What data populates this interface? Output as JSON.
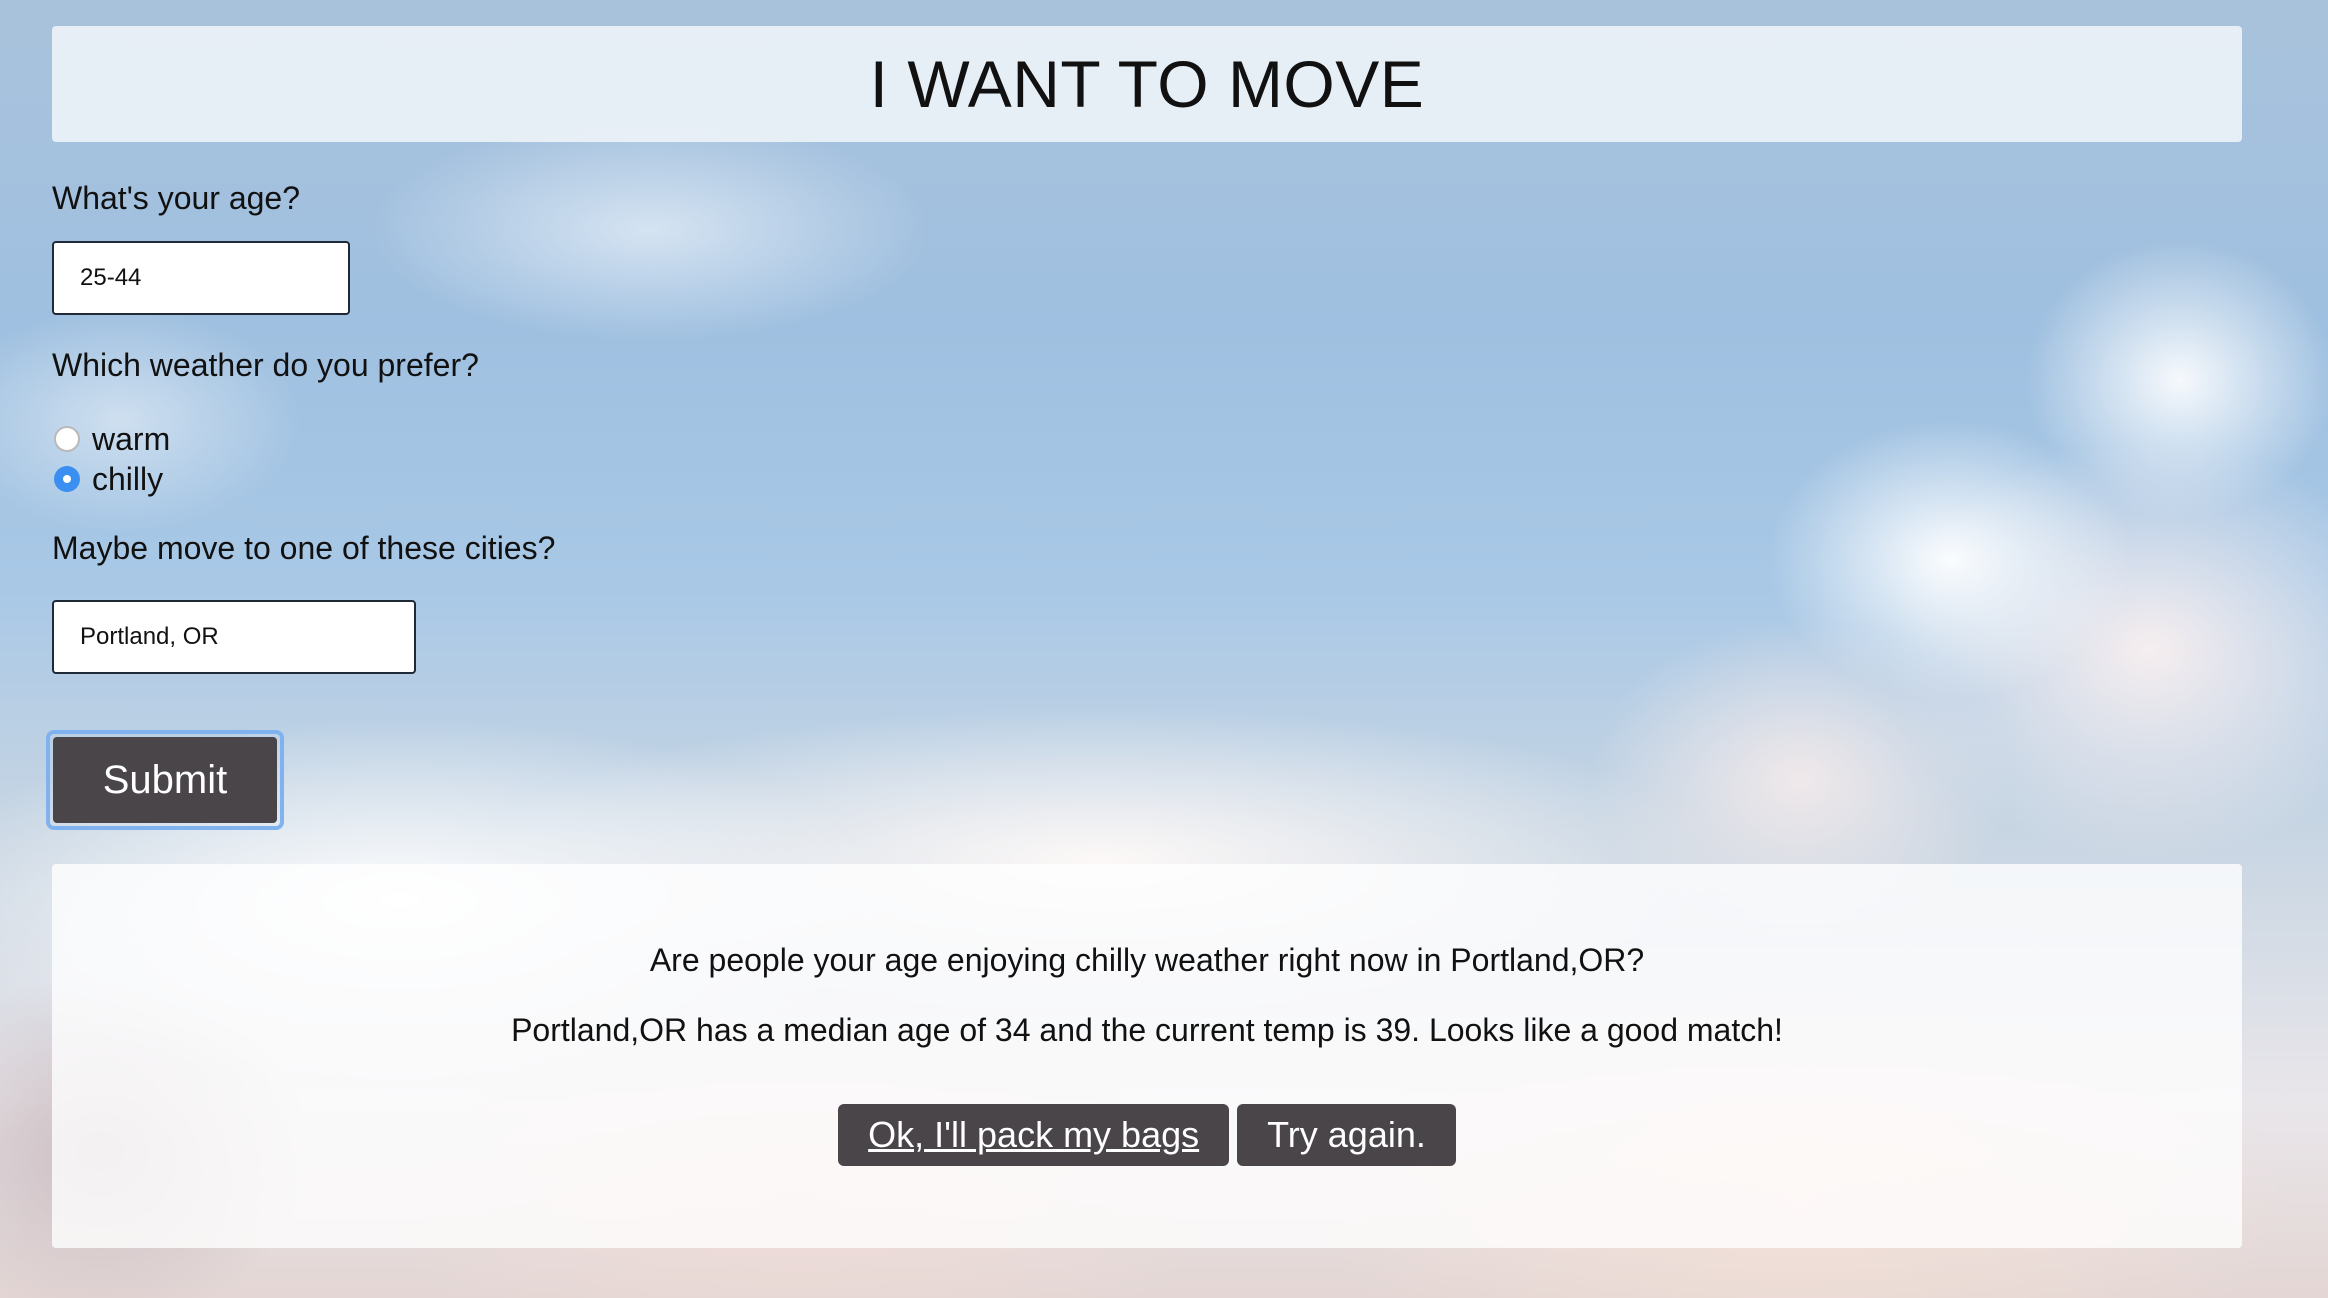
{
  "header": {
    "title": "I WANT TO MOVE"
  },
  "form": {
    "age_label": "What's your age?",
    "age_value": "25-44",
    "weather_label": "Which weather do you prefer?",
    "weather_options": [
      {
        "label": "warm",
        "checked": false
      },
      {
        "label": "chilly",
        "checked": true
      }
    ],
    "city_label": "Maybe move to one of these cities?",
    "city_value": "Portland, OR",
    "submit_label": "Submit"
  },
  "result": {
    "question": "Are people your age enjoying chilly weather right now in Portland,OR?",
    "answer": "Portland,OR has a median age of 34 and the current temp is 39. Looks like a good match!",
    "accept_label": "Ok, I'll pack my bags",
    "retry_label": "Try again."
  },
  "colors": {
    "button": "#4a4549",
    "radio_checked": "#3b8ff0",
    "focus_ring": "#7fb2ef"
  }
}
